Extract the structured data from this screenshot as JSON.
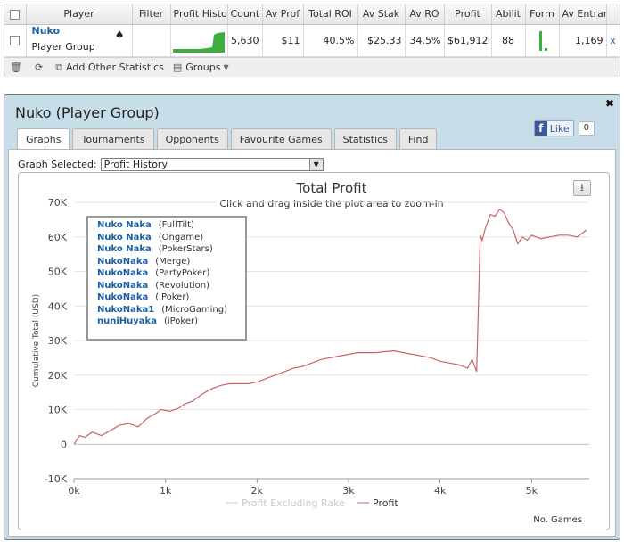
{
  "grid": {
    "columns": [
      "Player",
      "Filter",
      "Profit Histo",
      "Count",
      "Av Prof",
      "Total ROI",
      "Av Stak",
      "Av RO",
      "Profit",
      "Abilit",
      "Form",
      "Av Entrants"
    ],
    "row": {
      "player_name": "Nuko",
      "player_sub": "Player Group",
      "count": "5,630",
      "av_prof": "$11",
      "total_roi": "40.5%",
      "av_stake": "$25.33",
      "av_roi": "34.5%",
      "profit": "$61,912",
      "ability": "88",
      "av_entrants": "1,169",
      "remove": "x"
    },
    "toolbar": {
      "add_stats": "Add Other Statistics",
      "groups": "Groups"
    }
  },
  "dialog": {
    "title": "Nuko (Player Group)",
    "like_label": "Like",
    "like_count": "0",
    "tabs": [
      "Graphs",
      "Tournaments",
      "Opponents",
      "Favourite Games",
      "Statistics",
      "Find"
    ],
    "active_tab": "Graphs",
    "graph_selected_label": "Graph Selected:",
    "graph_selected_value": "Profit History"
  },
  "chart_data": {
    "type": "line",
    "title": "Total Profit",
    "subtitle": "Click and drag inside the plot area to zoom-in",
    "xlabel": "No. Games",
    "ylabel": "Cumulative Total (USD)",
    "xlim": [
      0,
      5630
    ],
    "ylim": [
      -10000,
      70000
    ],
    "x_ticks": [
      "0k",
      "1k",
      "2k",
      "3k",
      "4k",
      "5k"
    ],
    "y_ticks": [
      "-10K",
      "0",
      "10K",
      "20K",
      "30K",
      "40K",
      "50K",
      "60K",
      "70K"
    ],
    "grid": true,
    "accounts": [
      {
        "name": "Nuko Naka",
        "site": "(FullTilt)"
      },
      {
        "name": "Nuko Naka",
        "site": "(Ongame)"
      },
      {
        "name": "Nuko Naka",
        "site": "(PokerStars)"
      },
      {
        "name": "NukoNaka",
        "site": "(Merge)"
      },
      {
        "name": "NukoNaka",
        "site": "(PartyPoker)"
      },
      {
        "name": "NukoNaka",
        "site": "(Revolution)"
      },
      {
        "name": "NukoNaka",
        "site": "(iPoker)"
      },
      {
        "name": "NukoNaka1",
        "site": "(MicroGaming)"
      },
      {
        "name": "nuniHuyaka",
        "site": "(iPoker)"
      }
    ],
    "series": [
      {
        "name": "Profit Excluding Rake",
        "color": "#cccccc",
        "x": [],
        "y": []
      },
      {
        "name": "Profit",
        "color": "#c86464",
        "x": [
          0,
          60,
          120,
          200,
          300,
          400,
          500,
          600,
          700,
          800,
          900,
          950,
          1050,
          1150,
          1200,
          1300,
          1400,
          1500,
          1600,
          1700,
          1800,
          1900,
          2000,
          2100,
          2200,
          2300,
          2400,
          2500,
          2600,
          2700,
          2800,
          2900,
          3000,
          3100,
          3200,
          3300,
          3400,
          3500,
          3600,
          3700,
          3800,
          3900,
          4000,
          4100,
          4200,
          4300,
          4350,
          4400,
          4440,
          4460,
          4500,
          4550,
          4600,
          4650,
          4700,
          4750,
          4800,
          4850,
          4900,
          4950,
          5000,
          5100,
          5200,
          5300,
          5400,
          5500,
          5600
        ],
        "y": [
          0,
          2500,
          2000,
          3500,
          2500,
          4000,
          5500,
          6000,
          5000,
          7500,
          9000,
          10000,
          9500,
          10500,
          11500,
          12500,
          14500,
          16000,
          17000,
          17500,
          17500,
          17500,
          18000,
          19000,
          20000,
          21000,
          22000,
          22500,
          23500,
          24500,
          25000,
          25500,
          26000,
          26500,
          26500,
          26500,
          26800,
          27000,
          26500,
          26000,
          25500,
          25000,
          24000,
          23500,
          23000,
          22000,
          24500,
          21000,
          60500,
          59000,
          63000,
          66500,
          66000,
          68000,
          67000,
          64000,
          62000,
          58000,
          60000,
          59000,
          60500,
          59500,
          60000,
          60500,
          60500,
          60000,
          62000
        ]
      }
    ]
  }
}
